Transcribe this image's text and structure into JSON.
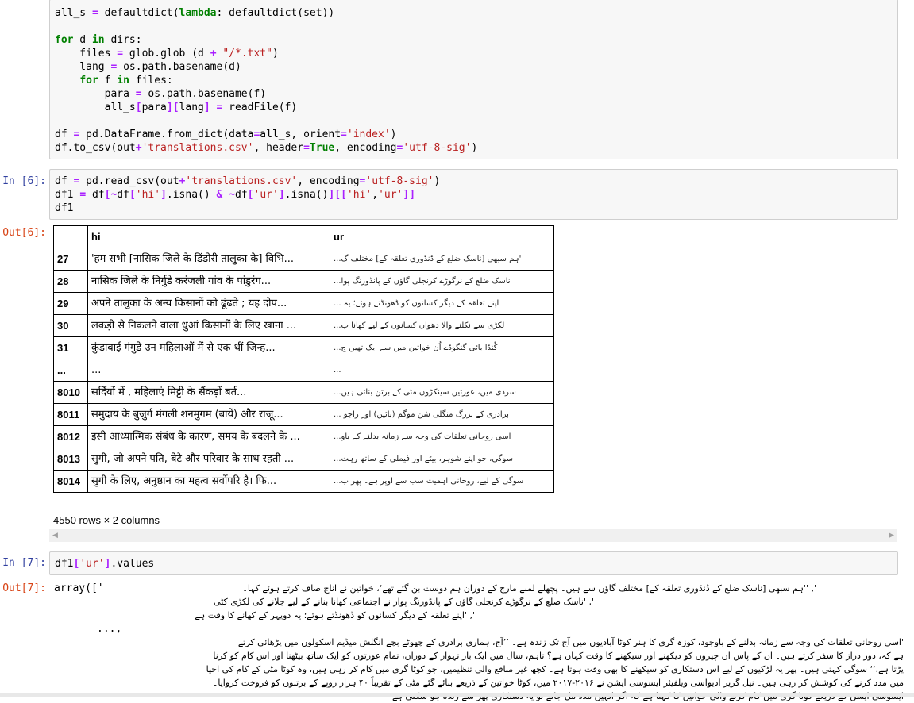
{
  "cell_top": {
    "lines": [
      "all_s = defaultdict(lambda: defaultdict(set))",
      "",
      "for d in dirs:",
      "    files = glob.glob (d + \"/*.txt\")",
      "    lang = os.path.basename(d)",
      "    for f in files:",
      "        para = os.path.basename(f)",
      "        all_s[para][lang] = readFile(f)",
      "",
      "df = pd.DataFrame.from_dict(data=all_s, orient='index')",
      "df.to_csv(out+'translations.csv', header=True, encoding='utf-8-sig')"
    ]
  },
  "cell6": {
    "in_prompt": "In [6]:",
    "out_prompt": "Out[6]:",
    "lines": [
      "df = pd.read_csv(out+'translations.csv', encoding='utf-8-sig')",
      "df1 = df[~df['hi'].isna() & ~df['ur'].isna()][['hi','ur']]",
      "df1"
    ],
    "table": {
      "columns": [
        "",
        "hi",
        "ur"
      ],
      "rows": [
        {
          "idx": "27",
          "hi": "'हम सभी [नासिक जिले के डिंडोरी तालुका के] विभि...",
          "ur": "...ہم سبھی [ناسک ضلع کے ڈنڈوری تعلقہ کے] مختلف گ'"
        },
        {
          "idx": "28",
          "hi": "नासिक जिले के निर्गुडे करंजली गांव के पांडुरंग...",
          "ur": "...ناسک ضلع کے نرگوڑے کرنجلی گاؤں کے پانڈورنگ پوا"
        },
        {
          "idx": "29",
          "hi": "अपने तालुका के अन्य किसानों को ढूंढते ; यह दोप...",
          "ur": "... اپنے تعلقہ کے دیگر کسانوں کو ڈھونڈتے ہوئے؛ یہ"
        },
        {
          "idx": "30",
          "hi": "लकड़ी से निकलने वाला धुआं किसानों के लिए खाना ...",
          "ur": "...لکڑی سے نکلنے والا دھواں کسانوں کے لیے کھانا ب"
        },
        {
          "idx": "31",
          "hi": "कुंडाबाई गंगुडे उन महिलाओं में से एक थीं जिन्ह...",
          "ur": "...کُنڈا بائی گنگوڈے اُن خواتین میں سے ایک تھیں ج"
        },
        {
          "idx": "...",
          "hi": "...",
          "ur": "..."
        },
        {
          "idx": "8010",
          "hi": "सर्दियों में , महिलाएं मिट्टी के सैंकड़ों बर्त...",
          "ur": "...سردی میں، عورتیں سینکڑوں مٹی کے برتن بناتی ہیں"
        },
        {
          "idx": "8011",
          "hi": "समुदाय के बुजुर्ग मंगली शनमुगम (बायें) और राजू...",
          "ur": "... برادری کے بزرگ منگلی شن موگم (بائیں) اور راجو"
        },
        {
          "idx": "8012",
          "hi": "इसी आध्यात्मिक संबंध के कारण, समय के बदलने के ...",
          "ur": "...اسی روحانی تعلقات کی وجہ سے زمانہ بدلنے کے باو"
        },
        {
          "idx": "8013",
          "hi": "सुगी, जो अपने पति, बेटे और परिवार के साथ रहती ...",
          "ur": "...سوگی، جو اپنے شوہر، بیٹے اور فیملی کے ساتھ رہت"
        },
        {
          "idx": "8014",
          "hi": "सुगी के लिए, अनुष्ठान का महत्व सर्वोपरि है। फि...",
          "ur": "...سوگی کے لیے، روحانی اہمیت سب سے اوپر ہے۔ پھر ب"
        }
      ],
      "shape_text": "4550 rows × 2 columns"
    }
  },
  "cell7": {
    "in_prompt": "In [7]:",
    "out_prompt": "Out[7]:",
    "code": "df1['ur'].values",
    "output": {
      "prefix": "array(['",
      "lines": [
        "ہم سبھی [ناسک ضلع کے ڈنڈوری تعلقہ کے] مختلف گاؤں سے ہیں۔ پچھلے لمبے مارچ کے دوران ہم دوست بن گئے تھے‘، خواتین نے اناج صاف کرتے ہوئے کہا۔'' ,'",
        "ناسک ضلع کے نرگوڑے کرنجلی گاؤں کے پانڈورنگ پوار نے اجتماعی کھانا بنانے کے لیے جلانے کی لکڑی کٹی' ,'",
        "اپنے تعلقہ کے دیگر کسانوں کو ڈھونڈتے ہوئے؛ یہ دوپہر کے کھانے کا وقت ہے' ,'",
        "...,",
        "اسی روحانی تعلقات کی وجہ سے زمانہ بدلنے کے باوجود، کوزہ گری کا ہنر کوٹا آبادیوں میں آج تک زندہ ہے۔ ’’آج، ہماری برادری کے چھوٹے بچے انگلش میڈیم اسکولوں میں پڑھائی کرتے'",
        "ہے کہ، دور دراز کا سفر کرتے ہیں۔ ان کے پاس ان چیزوں کو دیکھنے اور سیکھنے کا وقت کہاں ہے؟ تاہم، سال میں ایک بار تہوار کے دوران، تمام عورتوں کو ایک ساتھ بیٹھنا اور اس کام کو کرنا",
        "پڑتا ہے،‘‘ سوگی کہتی ہیں۔ پھر یہ لڑکیوں کے لیے اس دستکاری کو سیکھنے کا بھی وقت ہوتا ہے۔ کچھ غیر منافع والی تنظیمیں، جو کوٹا گری میں کام کر رہی ہیں، وہ کوٹا مٹی کے کام کی احیا",
        "میں مدد کرنے کی کوشش کر رہی ہیں۔ نیل گریز آدیواسی ویلفیئر ایسوسی ایشن نے ۲۰۱۶-۲۰۱۷ میں، کوٹا خواتین کے ذریعے بنائے گئے مٹی کے تقریباً ۴۰ ہزار روپے کے برتنوں کو فروخت کروایا۔",
        "ایسوسی ایشن کے ذریعے کوٹا گری میں کام کرنے والی خواتین کا کہنا ہے کہ اگر انہیں مدد مل جائے تو یہ دستکاری پھر سے زندہ ہو سکتی ہے"
      ]
    }
  }
}
